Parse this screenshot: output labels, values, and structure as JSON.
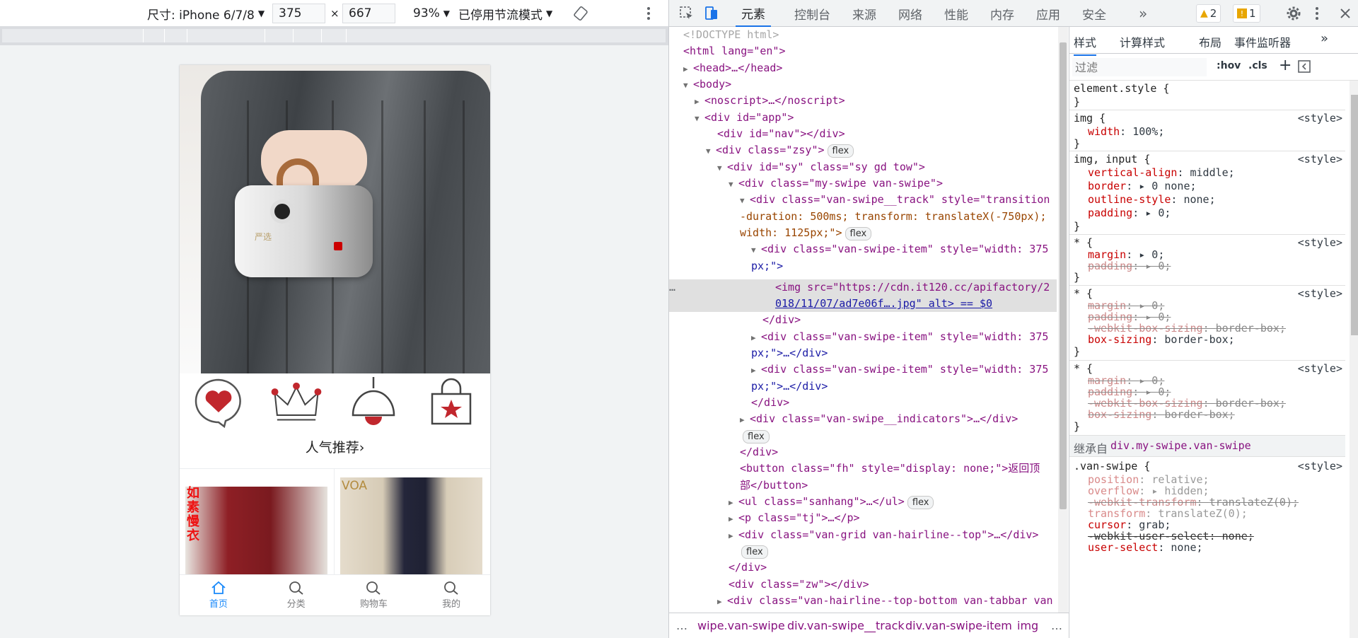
{
  "device_toolbar": {
    "dimensions_label": "尺寸: iPhone 6/7/8",
    "width": "375",
    "height": "667",
    "times": "×",
    "zoom": "93%",
    "throttle": "已停用节流模式"
  },
  "phone": {
    "banner_brand_text": "严选",
    "recommend_title": "人气推荐",
    "recommend_arrow": "›",
    "product1_label": "如素慢衣",
    "product2_label": "VOA",
    "tabs": [
      {
        "label": "首页",
        "icon": "home-icon"
      },
      {
        "label": "分类",
        "icon": "search-icon"
      },
      {
        "label": "购物车",
        "icon": "search-icon"
      },
      {
        "label": "我的",
        "icon": "search-icon"
      }
    ],
    "nav_icons": [
      "heart-chat-icon",
      "crown-icon",
      "lamp-icon",
      "shopping-bag-star-icon"
    ],
    "accent": "#1989fa",
    "icon_red": "#c1272d"
  },
  "devtools": {
    "tabs": [
      "元素",
      "控制台",
      "来源",
      "网络",
      "性能",
      "内存",
      "应用",
      "安全"
    ],
    "more": "»",
    "warnings": "2",
    "issues": "1",
    "elements_lines": [
      "<!DOCTYPE html>",
      "<html lang=\"en\">",
      "<head>…</head>",
      "<body>",
      "<noscript>…</noscript>",
      "<div id=\"app\">",
      "<div id=\"nav\"></div>",
      "<div class=\"zsy\">",
      "<div id=\"sy\" class=\"sy gd tow\">",
      "<div class=\"my-swipe van-swipe\">",
      "<div class=\"van-swipe__track\" style=\"transition",
      "-duration: 500ms; transform: translateX(-750px);",
      "width: 1125px;\">",
      "<div class=\"van-swipe-item\" style=\"width: 375",
      "px;\">",
      "<img src=\"https://cdn.it120.cc/apifactory/2",
      "018/11/07/ad7e06f….jpg\" alt> == $0",
      "</div>",
      "<div class=\"van-swipe-item\" style=\"width: 375",
      "px;\">…</div>",
      "<div class=\"van-swipe-item\" style=\"width: 375",
      "px;\">…</div>",
      "</div>",
      "<div class=\"van-swipe__indicators\">…</div>",
      "</div>",
      "<button class=\"fh\" style=\"display: none;\">返回顶",
      "部</button>",
      "<ul class=\"sanhang\">…</ul>",
      "<p class=\"tj\">…</p>",
      "<div class=\"van-grid van-hairline--top\">…</div>",
      "</div>",
      "<div class=\"zw\"></div>",
      "<div class=\"van-hairline--top-bottom van-tabbar van"
    ],
    "pill_flex": "flex",
    "ellipsis": "…",
    "breadcrumbs": [
      "…",
      "wipe.van-swipe",
      "div.van-swipe__track",
      "div.van-swipe-item",
      "img",
      "…"
    ],
    "styles": {
      "tabs": [
        "样式",
        "计算样式",
        "布局",
        "事件监听器"
      ],
      "filter_placeholder": "过滤",
      "hov": ":hov",
      "cls": ".cls",
      "plus": "+",
      "element_style": "element.style {",
      "close": "}",
      "src": "<style>",
      "rules": [
        {
          "sel": "img {",
          "props": [
            {
              "p": "width",
              "v": "100%;",
              "s": false
            }
          ]
        },
        {
          "sel": "img, input {",
          "props": [
            {
              "p": "vertical-align",
              "v": "middle;",
              "s": false
            },
            {
              "p": "border",
              "v": "▸ 0 none;",
              "s": false
            },
            {
              "p": "outline-style",
              "v": "none;",
              "s": false
            },
            {
              "p": "padding",
              "v": "▸ 0;",
              "s": false
            }
          ]
        },
        {
          "sel": "* {",
          "props": [
            {
              "p": "margin",
              "v": "▸ 0;",
              "s": false
            },
            {
              "p": "padding",
              "v": "▸ 0;",
              "s": true
            }
          ]
        },
        {
          "sel": "* {",
          "props": [
            {
              "p": "margin",
              "v": "▸ 0;",
              "s": true
            },
            {
              "p": "padding",
              "v": "▸ 0;",
              "s": true
            },
            {
              "p": "-webkit-box-sizing",
              "v": "border-box;",
              "s": true
            },
            {
              "p": "box-sizing",
              "v": "border-box;",
              "s": false
            }
          ]
        },
        {
          "sel": "* {",
          "props": [
            {
              "p": "margin",
              "v": "▸ 0;",
              "s": true
            },
            {
              "p": "padding",
              "v": "▸ 0;",
              "s": true
            },
            {
              "p": "-webkit-box-sizing",
              "v": "border-box;",
              "s": true
            },
            {
              "p": "box-sizing",
              "v": "border-box;",
              "s": true
            }
          ]
        }
      ],
      "inherited_label": "继承自",
      "inherited_from": "div.my-swipe.van-swipe",
      "van_swipe_sel": ".van-swipe {",
      "van_swipe_props": [
        {
          "p": "position",
          "v": "relative;",
          "s": false,
          "f": true
        },
        {
          "p": "overflow",
          "v": "▸ hidden;",
          "s": false,
          "f": true
        },
        {
          "p": "-webkit-transform",
          "v": "translateZ(0);",
          "s": true,
          "f": true
        },
        {
          "p": "transform",
          "v": "translateZ(0);",
          "s": false,
          "f": true
        },
        {
          "p": "cursor",
          "v": "grab;",
          "s": false,
          "f": false
        },
        {
          "p": "-webkit-user-select",
          "v": "none;",
          "s": true,
          "f": false
        },
        {
          "p": "user-select",
          "v": "none;",
          "s": false,
          "f": false
        }
      ]
    }
  }
}
